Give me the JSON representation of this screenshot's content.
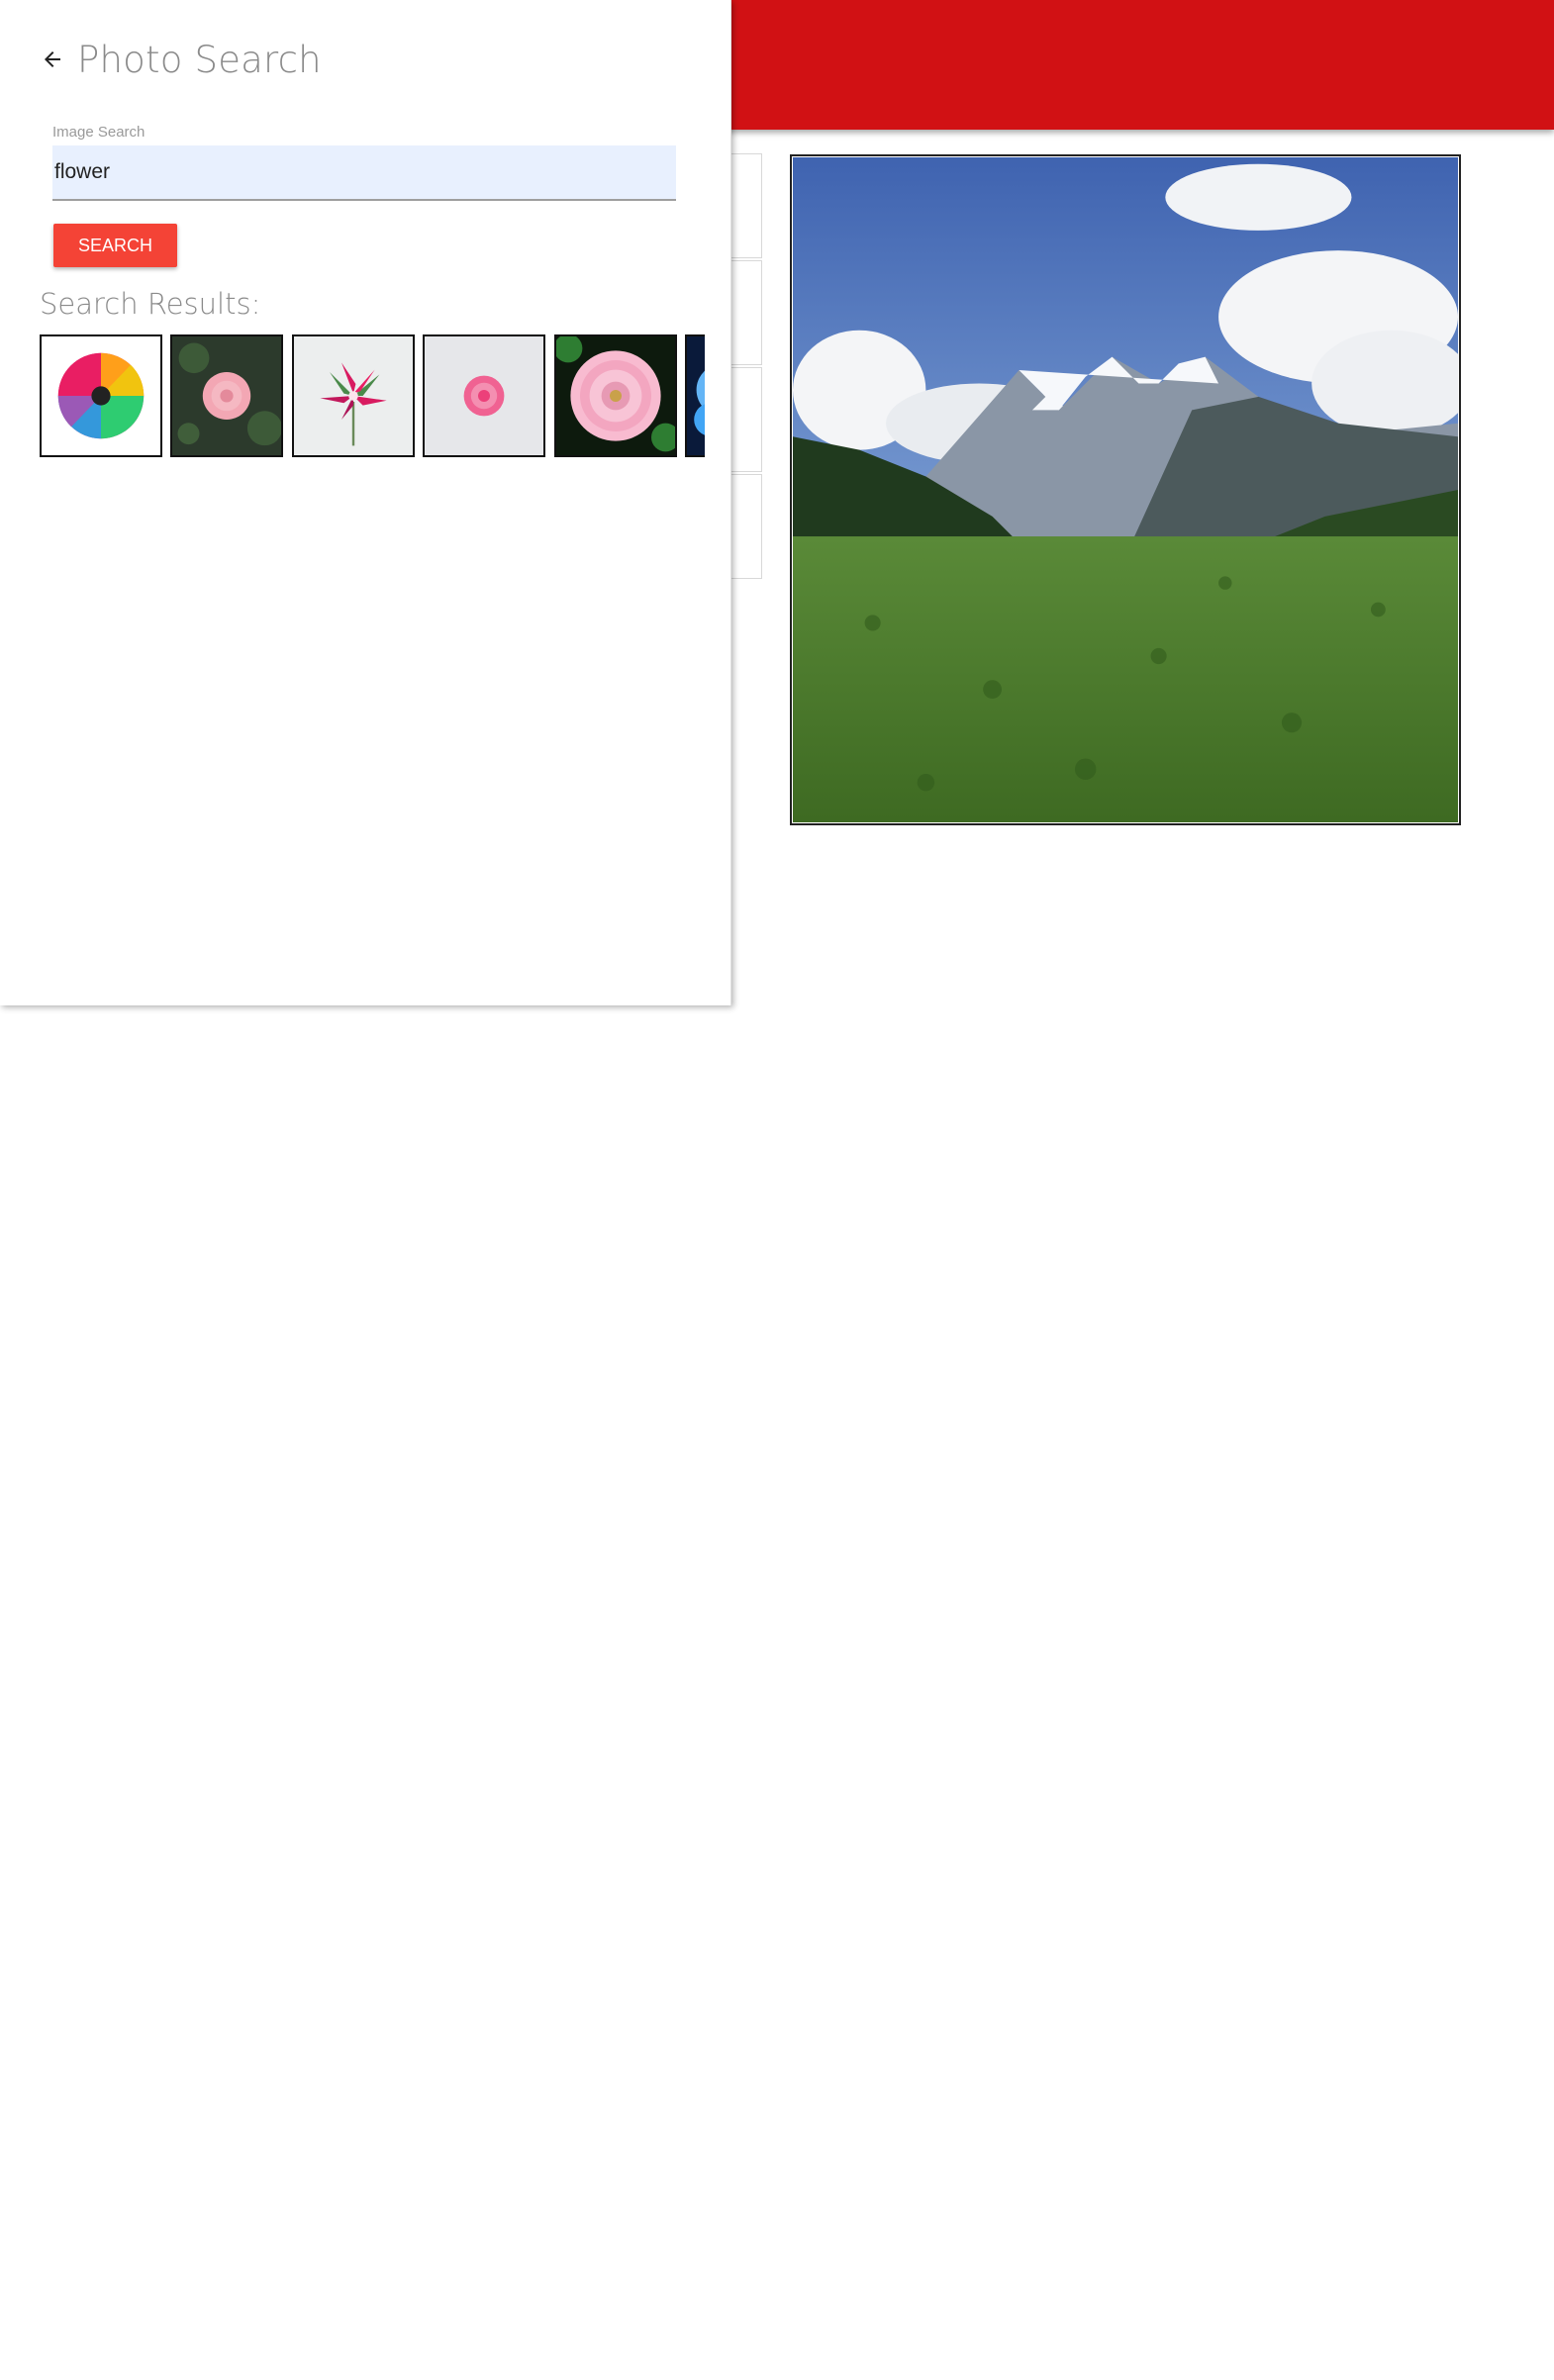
{
  "panel": {
    "title": "Photo Search",
    "back_icon": "arrow-left-icon"
  },
  "search": {
    "label": "Image Search",
    "value": "flower",
    "button_label": "SEARCH"
  },
  "results": {
    "heading": "Search Results:",
    "items": [
      {
        "subject": "rainbow chrysanthemum"
      },
      {
        "subject": "pink rose on dark foliage"
      },
      {
        "subject": "pink lily"
      },
      {
        "subject": "pink rose top view"
      },
      {
        "subject": "pink dahlia"
      },
      {
        "subject": "blue flower"
      }
    ]
  },
  "colors": {
    "app_bar": "#d11114",
    "button": "#f44336",
    "input_bg": "#e8f0fe"
  }
}
